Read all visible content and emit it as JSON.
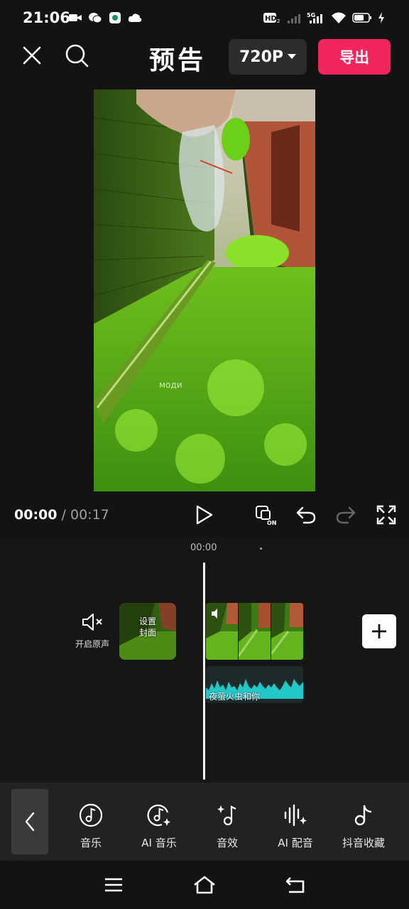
{
  "status_bar": {
    "time": "21:06",
    "left_icons": [
      "video-camera-icon",
      "wechat-icon",
      "app-icon",
      "cloud-icon"
    ],
    "right_icons": [
      "hd-voice-icon",
      "signal-icon",
      "5g-signal-icon",
      "wifi-icon",
      "battery-icon",
      "charging-icon"
    ],
    "hd_label": "HD",
    "network_label": "5G"
  },
  "topbar": {
    "title": "预告",
    "resolution": "720P",
    "export_label": "导出"
  },
  "preview": {
    "watermark": "моди"
  },
  "player": {
    "current_time": "00:00",
    "separator": "/",
    "total_time": "00:17"
  },
  "timeline": {
    "ruler_time": "00:00",
    "mute_label": "开启原声",
    "cover_label_line1": "设置",
    "cover_label_line2": "封面",
    "audio_track_label": "夜萤火虫和你"
  },
  "toolbar": {
    "items": [
      {
        "label": "音乐",
        "icon": "music-note-icon"
      },
      {
        "label": "AI 音乐",
        "icon": "ai-music-icon"
      },
      {
        "label": "音效",
        "icon": "sound-effect-icon"
      },
      {
        "label": "AI 配音",
        "icon": "ai-voice-icon"
      },
      {
        "label": "抖音收藏",
        "icon": "douyin-favorite-icon"
      }
    ]
  },
  "colors": {
    "accent": "#f2255c",
    "background": "#131313",
    "audio_wave": "#22c8c8"
  }
}
